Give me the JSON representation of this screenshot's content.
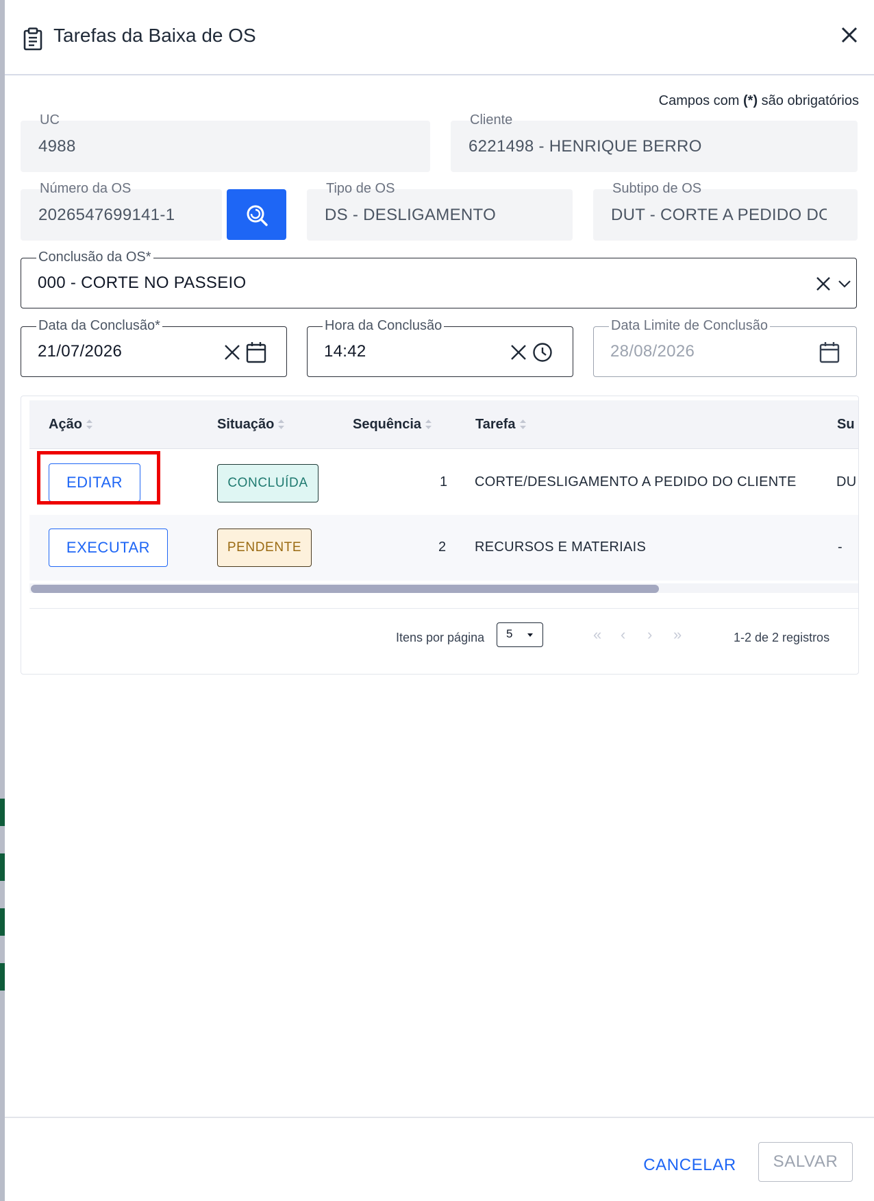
{
  "dialog": {
    "title": "Tarefas da Baixa de OS",
    "required_note_prefix": "Campos com ",
    "required_note_marker": "(*)",
    "required_note_suffix": " são obrigatórios"
  },
  "fields": {
    "uc": {
      "label": "UC",
      "value": "4988"
    },
    "cliente": {
      "label": "Cliente",
      "value": "6221498 - HENRIQUE BERRO"
    },
    "numero_os": {
      "label": "Número da OS",
      "value": "2026547699141-1"
    },
    "tipo_os": {
      "label": "Tipo de OS",
      "value": "DS - DESLIGAMENTO"
    },
    "subtipo_os": {
      "label": "Subtipo de OS",
      "value": "DUT - CORTE A PEDIDO DO"
    },
    "conclusao_os": {
      "label": "Conclusão da OS*",
      "value": "000 - CORTE NO PASSEIO"
    },
    "data_conclusao": {
      "label": "Data da Conclusão*",
      "value": "21/07/2026"
    },
    "hora_conclusao": {
      "label": "Hora da Conclusão",
      "value": "14:42"
    },
    "data_limite": {
      "label": "Data Limite de Conclusão",
      "value": "28/08/2026"
    }
  },
  "table": {
    "headers": {
      "acao": "Ação",
      "situacao": "Situação",
      "sequencia": "Sequência",
      "tarefa": "Tarefa",
      "subtipo": "Su"
    },
    "rows": [
      {
        "action": "EDITAR",
        "status": "CONCLUÍDA",
        "sequence": "1",
        "task": "CORTE/DESLIGAMENTO A PEDIDO DO CLIENTE",
        "extra": "DU"
      },
      {
        "action": "EXECUTAR",
        "status": "PENDENTE",
        "sequence": "2",
        "task": "RECURSOS E MATERIAIS",
        "extra": "-"
      }
    ]
  },
  "pagination": {
    "items_per_page_label": "Itens por página",
    "page_size": "5",
    "first": "«",
    "prev": "‹",
    "next": "›",
    "last": "»",
    "range": "1-2 de 2 registros"
  },
  "footer": {
    "cancel": "CANCELAR",
    "save": "SALVAR"
  },
  "colors": {
    "primary": "#1e66f5",
    "done_bg": "#dff6f3",
    "pending_bg": "#fdf1dc",
    "highlight": "#ee0000"
  }
}
